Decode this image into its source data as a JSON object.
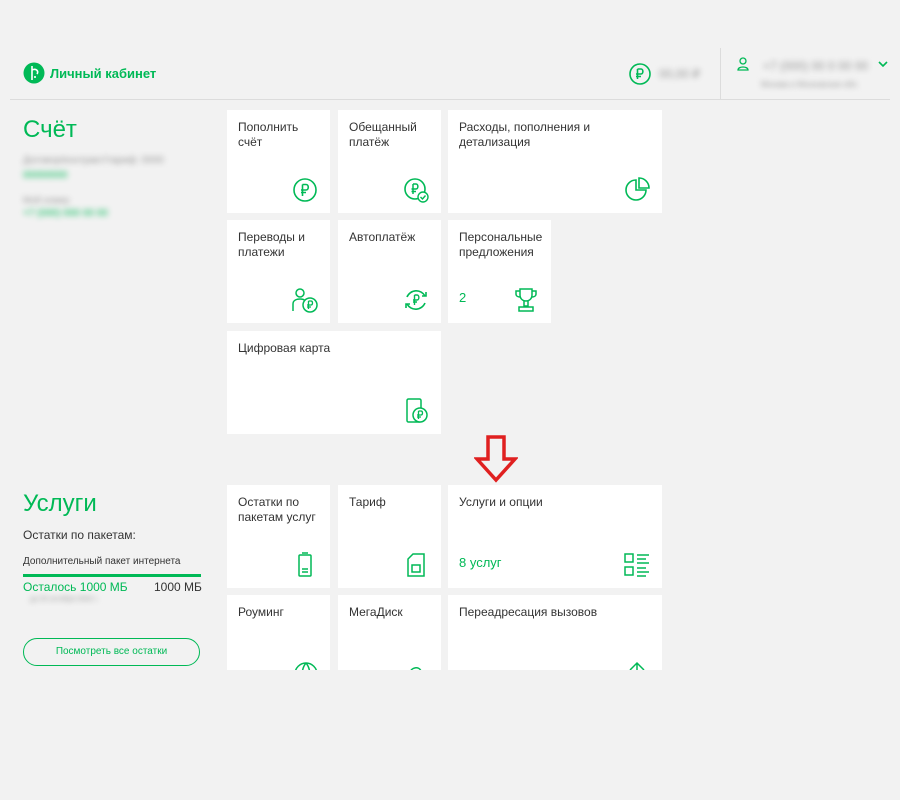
{
  "header": {
    "logo_text": "Личный кабинет",
    "balance_masked": "00,00 ₽",
    "user_phone_masked": "+7 (000) 00 0 00 00",
    "user_sub_masked": "Москва и Московская обл."
  },
  "account": {
    "title": "Счёт",
    "info_line1_masked": "Договор/контракт/тариф: 0000",
    "info_link1_masked": "00000000",
    "info_line2_masked": "Мой номер",
    "info_link2_masked": "+7 (000) 000 00 00"
  },
  "account_tiles": [
    {
      "label": "Пополнить счёт",
      "icon": "ruble-circle-icon"
    },
    {
      "label": "Обещанный платёж",
      "icon": "promised-payment-icon"
    },
    {
      "label": "Расходы, пополнения и детализация",
      "icon": "pie-chart-icon"
    },
    {
      "label": "Переводы и платежи",
      "icon": "person-ruble-icon"
    },
    {
      "label": "Автоплатёж",
      "icon": "autopay-icon"
    },
    {
      "label": "Персональные предложения",
      "count": "2",
      "icon": "trophy-icon"
    },
    {
      "label": "Цифровая карта",
      "icon": "digital-card-icon"
    }
  ],
  "services": {
    "title": "Услуги",
    "packages_label": "Остатки по пакетам:",
    "package_name": "Дополнительный пакет интернета",
    "remaining": "Осталось 1000 МБ",
    "total": "1000 МБ",
    "progress_fraction": 1.0,
    "expiry_masked": "до 00 октября 0000 г.",
    "view_all_button": "Посмотреть все остатки"
  },
  "service_tiles": [
    {
      "label": "Остатки по пакетам услуг",
      "icon": "battery-icon"
    },
    {
      "label": "Тариф",
      "icon": "sim-card-icon"
    },
    {
      "label": "Услуги и опции",
      "count": "8 услуг",
      "icon": "list-grid-icon"
    },
    {
      "label": "Роуминг",
      "icon": "globe-icon"
    },
    {
      "label": "МегаДиск",
      "icon": "cloud-icon"
    },
    {
      "label": "Переадресация вызовов",
      "icon": "forward-icon"
    }
  ],
  "colors": {
    "brand_green": "#00b956",
    "arrow_red": "#e02020"
  }
}
